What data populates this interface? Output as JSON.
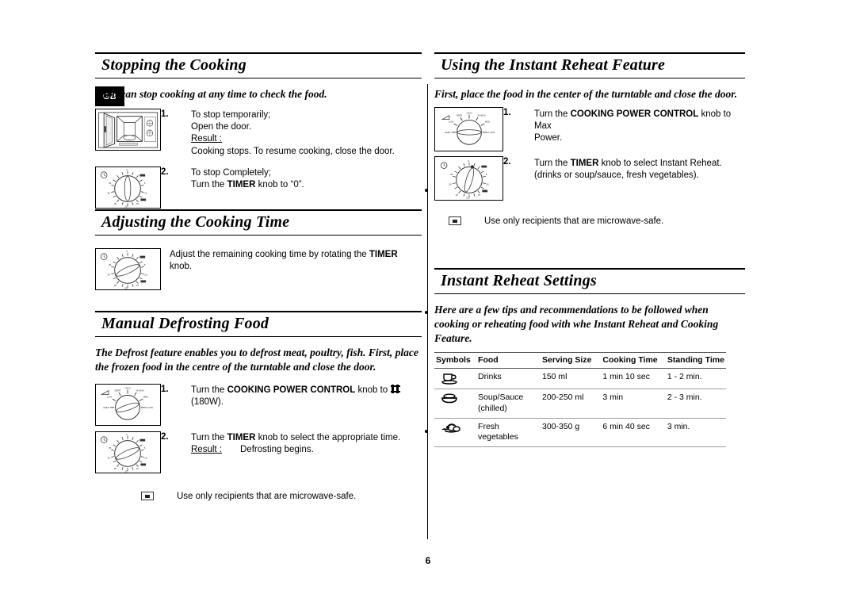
{
  "page": {
    "language_tab": "GB",
    "page_number": "6"
  },
  "left_column": {
    "sections": [
      {
        "id": "stopping-the-cooking",
        "title": "Stopping the Cooking",
        "intro": "You can stop cooking at any time to check the food.",
        "steps": [
          {
            "number": "1.",
            "figure": "microwave-open-door",
            "lines": [
              "To stop temporarily;",
              "Open the door."
            ],
            "result_label": "Result :",
            "result_text": "Cooking stops. To resume cooking, close the door."
          },
          {
            "number": "2.",
            "figure": "timer-knob-zero",
            "lines": [
              "To stop Completely;"
            ],
            "rich_line": {
              "before": "Turn the ",
              "keyword": "TIMER",
              "after": " knob to “0”."
            }
          }
        ]
      },
      {
        "id": "adjusting-the-cooking-time",
        "title": "Adjusting the Cooking Time",
        "steps": [
          {
            "figure": "timer-knob-set",
            "rich_line": {
              "before": "Adjust the remaining cooking time by rotating the ",
              "keyword": "TIMER",
              "after": " knob."
            }
          }
        ]
      },
      {
        "id": "manual-defrosting-food",
        "title": "Manual Defrosting Food",
        "intro": "The Defrost feature enables you to defrost meat, poultry, fish. First, place the frozen food in the centre of the turntable and close the door.",
        "steps": [
          {
            "number": "1.",
            "figure": "power-knob-defrost",
            "rich_line": {
              "before": "Turn the ",
              "keyword": "COOKING POWER CONTROL",
              "after": " knob to "
            },
            "glyph": "defrost-symbol",
            "second_line": "(180W)."
          },
          {
            "number": "2.",
            "figure": "timer-knob-set",
            "rich_line": {
              "before": "Turn the ",
              "keyword": "TIMER",
              "after": " knob to select the appropriate time."
            },
            "result_label": "Result :",
            "result_text": "Defrosting begins."
          }
        ],
        "note": "Use only recipients that are microwave-safe."
      }
    ]
  },
  "right_column": {
    "sections": [
      {
        "id": "using-the-instant-reheat-feature",
        "title": "Using the Instant Reheat Feature",
        "intro": "First, place the food in the center of the turntable and close the door.",
        "steps": [
          {
            "number": "1.",
            "figure": "power-knob-max",
            "rich_line": {
              "before": "Turn the ",
              "keyword": "COOKING POWER CONTROL",
              "after": " knob to Max"
            },
            "second_line": "Power."
          },
          {
            "number": "2.",
            "figure": "timer-knob-reheat",
            "rich_line": {
              "before": "Turn the ",
              "keyword": "TIMER",
              "after": " knob to select Instant Reheat."
            },
            "second_line": "(drinks or soup/sauce, fresh vegetables)."
          }
        ],
        "note": "Use only recipients that are microwave-safe."
      },
      {
        "id": "instant-reheat-settings",
        "title": "Instant Reheat Settings",
        "intro": "Here are a few tips and recommendations to be followed when cooking or reheating food with whe Instant Reheat and Cooking Feature.",
        "table": {
          "headers": [
            "Symbols",
            "Food",
            "Serving Size",
            "Cooking Time",
            "Standing Time"
          ],
          "rows": [
            {
              "symbol": "cup-saucer-icon",
              "food": "Drinks",
              "serving_size": "150 ml",
              "cooking_time": "1 min 10 sec",
              "standing_time": "1 - 2 min."
            },
            {
              "symbol": "soup-bowl-icon",
              "food": "Soup/Sauce (chilled)",
              "serving_size": "200-250 ml",
              "cooking_time": "3 min",
              "standing_time": "2 - 3 min."
            },
            {
              "symbol": "vegetables-icon",
              "food": "Fresh vegetables",
              "serving_size": "300-350 g",
              "cooking_time": "6 min 40 sec",
              "standing_time": "3 min."
            }
          ]
        }
      }
    ]
  }
}
